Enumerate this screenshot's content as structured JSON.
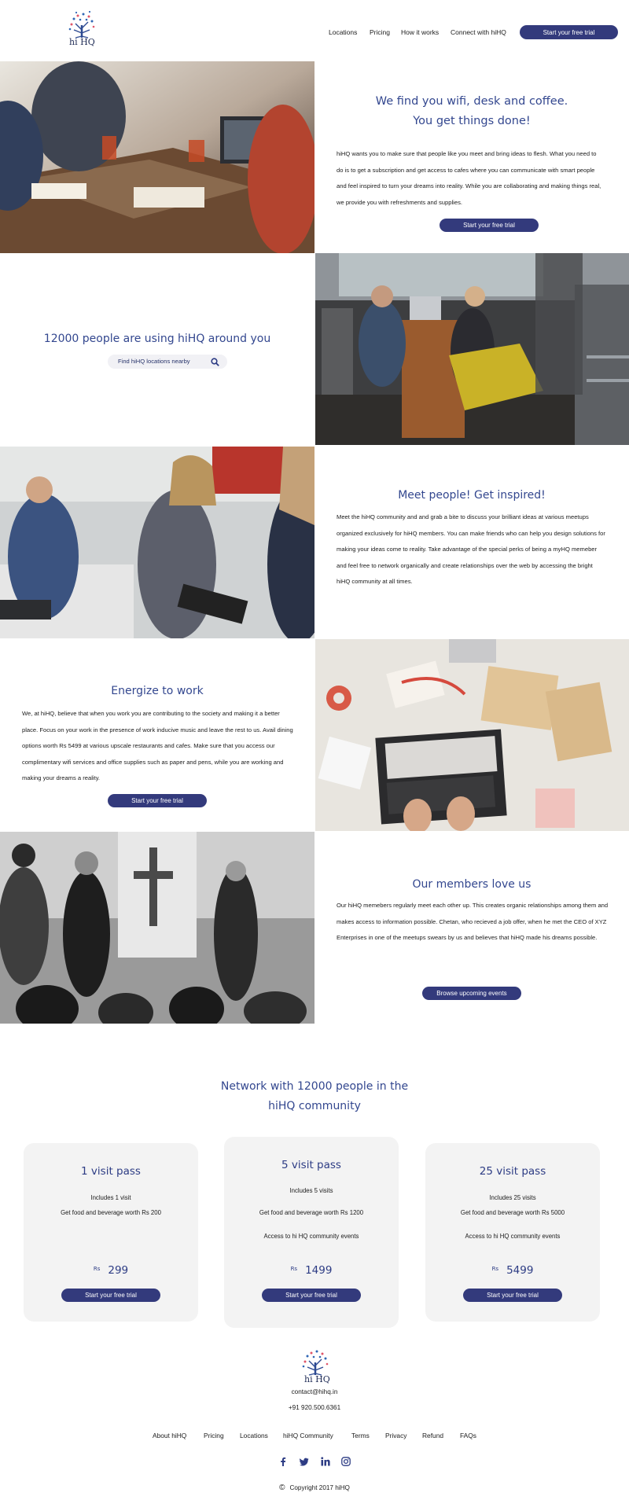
{
  "header": {
    "logo_text": "hi HQ",
    "nav": [
      "Locations",
      "Pricing",
      "How it works",
      "Connect with hiHQ"
    ],
    "cta": "Start your free trial"
  },
  "sections": {
    "wifi": {
      "heading_line1": "We find you wifi, desk and coffee.",
      "heading_line2": "You get things done!",
      "body": "hiHQ wants you to make sure that people like you meet and bring ideas to flesh. What you need to do is to get a subscription and get access to cafes where you can communicate with smart people and feel inspired to turn your dreams into reality. While you are collaborating and making things real, we provide you with refreshments and supplies.",
      "cta": "Start your free trial"
    },
    "people": {
      "heading": "12000 people are using hiHQ around you",
      "search_placeholder": "Find hiHQ locations nearby"
    },
    "meet": {
      "heading": "Meet people! Get inspired!",
      "body": "Meet the hiHQ community and and grab a bite to discuss your brilliant ideas at various meetups organized exclusively for hiHQ members. You can make friends who can help you design solutions for making your ideas come to reality. Take advantage of the special perks of being a myHQ memeber and feel free to network organically and create relationships over the web by accessing the bright hiHQ community at all times."
    },
    "energize": {
      "heading": "Energize to work",
      "body": "We, at hiHQ, believe that when you work you are contributing to the society and making it a better place. Focus on your work in the presence of work inducive music and leave the rest to us. Avail dining options worth Rs 5499 at various upscale restaurants and cafes. Make sure that you access our complimentary wifi services and office supplies such as paper and pens, while you are working and making your dreams a reality.",
      "cta": "Start your free trial"
    },
    "members": {
      "heading": "Our members love us",
      "body": "Our hiHQ memebers regularly meet each other up. This creates organic relationships among them and makes access to information possible. Chetan, who recieved a job offer, when he met the CEO of XYZ Enterprises in one of the meetups swears by us and believes that hiHQ made his dreams possible.",
      "cta": "Browse upcoming events"
    }
  },
  "pricing": {
    "heading_line1": "Network with 12000 people in the",
    "heading_line2": "hiHQ community",
    "plans": [
      {
        "title": "1 visit pass",
        "lines": [
          "Includes 1 visit",
          "Get food and beverage worth Rs 200"
        ],
        "currency": "Rs",
        "price": "299",
        "cta": "Start your free trial"
      },
      {
        "title": "5 visit pass",
        "lines": [
          "Includes 5 visits",
          "Get food and beverage worth Rs 1200",
          "Access to hi HQ community events"
        ],
        "currency": "Rs",
        "price": "1499",
        "cta": "Start your free trial"
      },
      {
        "title": "25 visit pass",
        "lines": [
          "Includes 25 visits",
          "Get food and beverage worth Rs 5000",
          "Access to hi HQ community events"
        ],
        "currency": "Rs",
        "price": "5499",
        "cta": "Start your free trial"
      }
    ]
  },
  "footer": {
    "logo_text": "hi HQ",
    "email": "contact@hihq.in",
    "phone": "+91 920.500.6361",
    "links": [
      "About hiHQ",
      "Pricing",
      "Locations",
      "hiHQ Community",
      "Terms",
      "Privacy",
      "Refund",
      "FAQs"
    ],
    "social_icons": [
      "facebook-icon",
      "twitter-icon",
      "linkedin-icon",
      "instagram-icon"
    ],
    "copyright_symbol": "©",
    "copyright": "Copyright 2017 hiHQ"
  },
  "colors": {
    "brand": "#333a7c",
    "heading": "#33478f",
    "card_bg": "#f3f3f3"
  }
}
